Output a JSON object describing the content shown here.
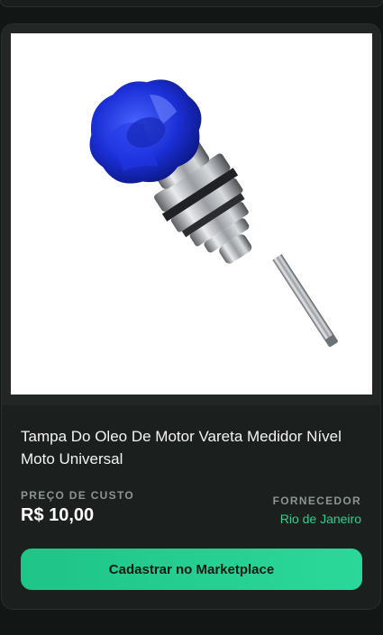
{
  "product": {
    "title": "Tampa Do Oleo De Motor Vareta Medidor Nível Moto Universal",
    "image_alt": "Tampa do óleo azul com vareta medidora"
  },
  "pricing": {
    "label": "PREÇO DE CUSTO",
    "value": "R$ 10,00"
  },
  "supplier": {
    "label": "FORNECEDOR",
    "location": "Rio de Janeiro"
  },
  "actions": {
    "register_label": "Cadastrar no Marketplace"
  },
  "colors": {
    "accent": "#2fcf8e",
    "button": "#22cc8c",
    "card_bg": "#1b201e",
    "page_bg": "#121614"
  }
}
